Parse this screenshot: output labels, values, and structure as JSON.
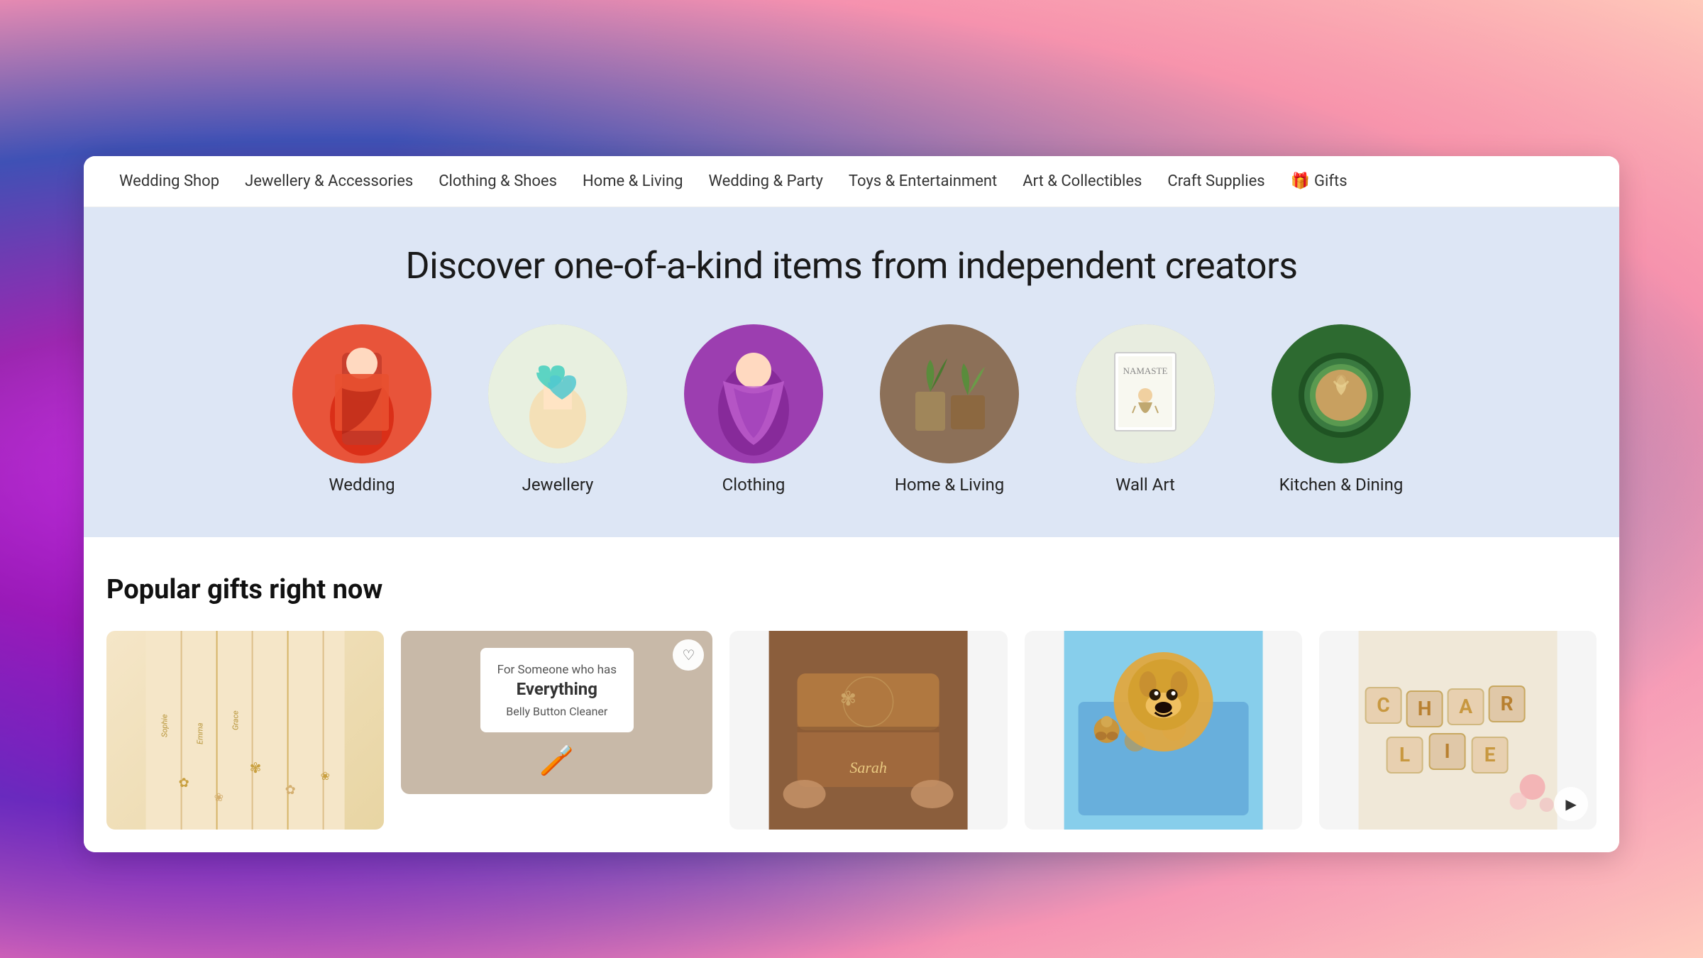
{
  "background": {
    "gradient": "pink-purple-peach"
  },
  "nav": {
    "items": [
      {
        "id": "wedding-shop",
        "label": "Wedding Shop"
      },
      {
        "id": "jewellery-accessories",
        "label": "Jewellery & Accessories"
      },
      {
        "id": "clothing-shoes",
        "label": "Clothing & Shoes"
      },
      {
        "id": "home-living",
        "label": "Home & Living"
      },
      {
        "id": "wedding-party",
        "label": "Wedding & Party"
      },
      {
        "id": "toys-entertainment",
        "label": "Toys & Entertainment"
      },
      {
        "id": "art-collectibles",
        "label": "Art & Collectibles"
      },
      {
        "id": "craft-supplies",
        "label": "Craft Supplies"
      },
      {
        "id": "gifts",
        "label": "Gifts",
        "icon": "🎁"
      }
    ]
  },
  "hero": {
    "title": "Discover one-of-a-kind items from independent creators"
  },
  "categories": [
    {
      "id": "wedding",
      "label": "Wedding",
      "emoji": "👘",
      "colorClass": "cat-wedding"
    },
    {
      "id": "jewellery",
      "label": "Jewellery",
      "emoji": "💎",
      "colorClass": "cat-jewellery"
    },
    {
      "id": "clothing",
      "label": "Clothing",
      "emoji": "👗",
      "colorClass": "cat-clothing"
    },
    {
      "id": "home-living",
      "label": "Home & Living",
      "emoji": "🌿",
      "colorClass": "cat-homeliving"
    },
    {
      "id": "wall-art",
      "label": "Wall Art",
      "emoji": "🖼️",
      "colorClass": "cat-wallart"
    },
    {
      "id": "kitchen-dining",
      "label": "Kitchen & Dining",
      "emoji": "☕",
      "colorClass": "cat-kitchen"
    }
  ],
  "popular_section": {
    "title": "Popular gifts right now"
  },
  "products": [
    {
      "id": "prod-1",
      "type": "necklaces",
      "alt": "Name necklaces gold chains",
      "has_wishlist": false,
      "has_play": false
    },
    {
      "id": "prod-2",
      "type": "belly-button-cleaner",
      "title_line1": "For Someone who has",
      "title_line2": "Everything",
      "title_line3": "Belly Button Cleaner",
      "has_wishlist": true,
      "has_play": false
    },
    {
      "id": "prod-3",
      "type": "sarah-box",
      "alt": "Personalised leather jewellery box Sarah",
      "has_wishlist": false,
      "has_play": false
    },
    {
      "id": "prod-4",
      "type": "dog-blanket",
      "alt": "Custom dog photo blanket golden retriever",
      "has_wishlist": false,
      "has_play": false
    },
    {
      "id": "prod-5",
      "type": "charlie-puzzle",
      "alt": "Charlie name puzzle letters",
      "has_wishlist": false,
      "has_play": true
    }
  ],
  "icons": {
    "heart": "♡",
    "heart_filled": "♥",
    "gift": "🎁",
    "play": "▶"
  }
}
